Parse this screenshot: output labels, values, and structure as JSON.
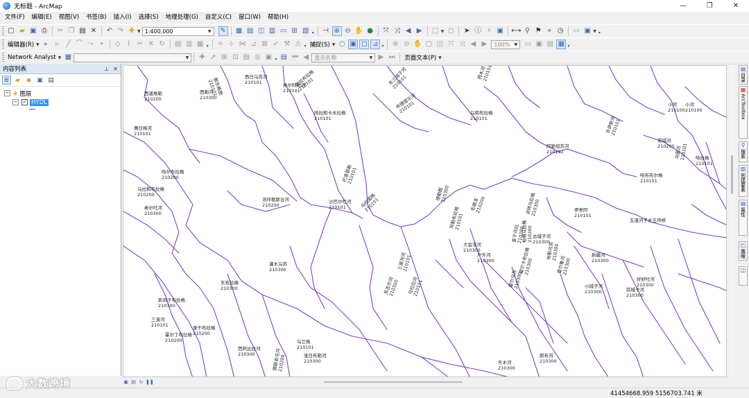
{
  "window": {
    "title": "无标题 - ArcMap",
    "controls": [
      "—",
      "❐",
      "✕"
    ]
  },
  "menu": [
    "文件(F)",
    "编辑(E)",
    "视图(V)",
    "书签(B)",
    "插入(I)",
    "选择(S)",
    "地理处理(G)",
    "自定义(C)",
    "窗口(W)",
    "帮助(H)"
  ],
  "standard_toolbar": {
    "scale_value": "1:400,000"
  },
  "editor_toolbar": {
    "editor_label": "编辑器(R)",
    "snapping_label": "捕捉(S)",
    "zoom_percent": "100%"
  },
  "network_toolbar": {
    "network_label": "Network Analyst",
    "display_field_placeholder": "显示名称",
    "page_text_label": "页面文本(P)"
  },
  "toc": {
    "title": "内容列表",
    "pin": "⊥",
    "close": "✕",
    "data_frame": "图层",
    "layer_name": "HYDL"
  },
  "map": {
    "line_color": "#7a3fd1",
    "labels": [
      {
        "name": "西道格勒",
        "code": "210200"
      },
      {
        "name": "西勒河",
        "code": "210300"
      },
      {
        "name": "都乐格图",
        "code": "210101"
      },
      {
        "name": "希尔科勒河",
        "code": "210101"
      },
      {
        "name": "哈拉布拉格",
        "code": "210101"
      },
      {
        "name": "东三道子河",
        "code": "210101"
      },
      {
        "name": "西木河",
        "code": "210101"
      },
      {
        "name": "小河",
        "code": "210100"
      },
      {
        "name": "小河",
        "code": "210100"
      },
      {
        "name": "赛日格河",
        "code": "210101"
      },
      {
        "name": "哈拉和卡木拉格",
        "code": "210101"
      },
      {
        "name": "布德音乐河",
        "code": "210101"
      },
      {
        "name": "西日乌苏河",
        "code": "210101"
      },
      {
        "name": "乌和布拉格",
        "code": "210101"
      },
      {
        "name": "东伊斯河",
        "code": "210101"
      },
      {
        "name": "哥城河",
        "code": "210200"
      },
      {
        "name": "哈拉格",
        "code": "210101"
      },
      {
        "name": "哈尔布拉格",
        "code": "210200"
      },
      {
        "name": "乌拉和布拉格",
        "code": "210200"
      },
      {
        "name": "希尔吐河",
        "code": "210300"
      },
      {
        "name": "浩坪勒斯台河",
        "code": "210200"
      },
      {
        "name": "沙巴尔吐河",
        "code": "210101"
      },
      {
        "name": "巴音郭勒",
        "code": "210101"
      },
      {
        "name": "乌拉图格",
        "code": "210101"
      },
      {
        "name": "德勒图",
        "code": "210300"
      },
      {
        "name": "阿勒坦苏河",
        "code": "210101"
      },
      {
        "name": "伊舍阿",
        "code": "210101"
      },
      {
        "name": "五道河子乡五坪桥",
        "code": ""
      },
      {
        "name": "哈布布尔格",
        "code": "210101"
      },
      {
        "name": "乌图河",
        "code": "210101"
      },
      {
        "name": "查干乌拉",
        "code": "210200"
      },
      {
        "name": "阿勒布拉格",
        "code": "210101"
      },
      {
        "name": "柏格乌拉格",
        "code": "210300"
      },
      {
        "name": "毛德浑",
        "code": "210200"
      },
      {
        "name": "洪特乌拉格",
        "code": "210300"
      },
      {
        "name": "古城子河",
        "code": "210300"
      },
      {
        "name": "大金屯河",
        "code": "210300"
      },
      {
        "name": "户外河",
        "code": "210300"
      },
      {
        "name": "新疆河",
        "code": "210300"
      },
      {
        "name": "霍尔鲁河",
        "code": "210300"
      },
      {
        "name": "霍尔卡布拉格",
        "code": "210300"
      },
      {
        "name": "霍尔乌苏",
        "code": "210300"
      },
      {
        "name": "哈勒乌苏",
        "code": "210300"
      },
      {
        "name": "小城子河",
        "code": "210300"
      },
      {
        "name": "前城子河",
        "code": "210300"
      },
      {
        "name": "好好吐河",
        "code": "210300"
      },
      {
        "name": "灌木乌苏",
        "code": "210300"
      },
      {
        "name": "新洞子布拉格",
        "code": "210300"
      },
      {
        "name": "东布拉格",
        "code": "210300"
      },
      {
        "name": "三道河",
        "code": "210101"
      },
      {
        "name": "霍尔丁布拉格",
        "code": "210200"
      },
      {
        "name": "查干布拉格",
        "code": "210200"
      },
      {
        "name": "乌兰格",
        "code": "210101"
      },
      {
        "name": "德联会屯河",
        "code": "210200"
      },
      {
        "name": "西阿达拉河",
        "code": "210300"
      },
      {
        "name": "乌拉拉河",
        "code": "210101"
      },
      {
        "name": "三道沟河",
        "code": "210101"
      },
      {
        "name": "苏吉尔河",
        "code": "210300"
      },
      {
        "name": "宝日布勒河",
        "code": "210300"
      },
      {
        "name": "冬木河",
        "code": "210300"
      },
      {
        "name": "那布河",
        "code": "210300"
      }
    ]
  },
  "right_panel": [
    {
      "icon": "catalog-icon",
      "text": "目录"
    },
    {
      "icon": "arctoolbox-icon",
      "text": "ArcToolbox"
    },
    {
      "icon": "search-icon",
      "text": "搜索"
    },
    {
      "icon": "create-features-icon",
      "text": "创建要素"
    },
    {
      "icon": "attributes-icon",
      "text": "属性"
    },
    {
      "icon": "overview-icon",
      "text": "鹰眼"
    }
  ],
  "status": {
    "coordinates": "41454668.959  5156703.741 米"
  },
  "watermark": "大数跨境"
}
